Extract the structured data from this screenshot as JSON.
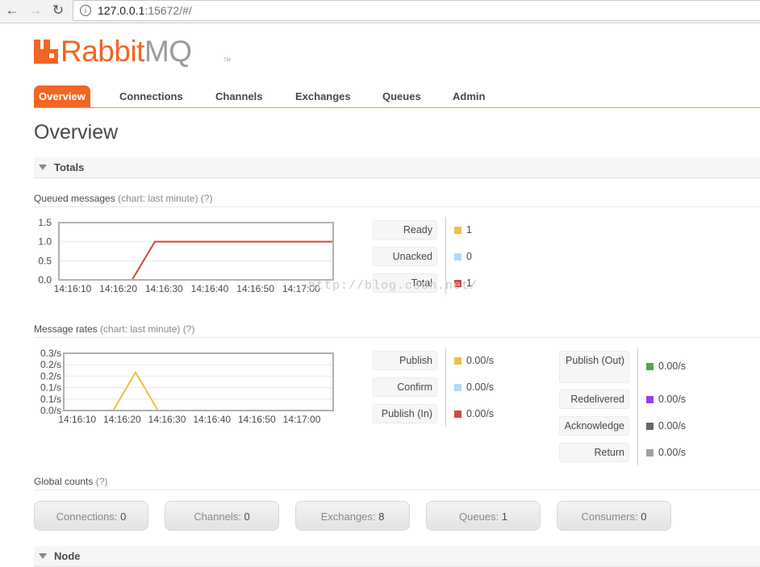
{
  "browser": {
    "url_host": "127.0.0.1",
    "url_rest": ":15672/#/"
  },
  "logo": {
    "brand_primary": "Rabbit",
    "brand_secondary": "MQ",
    "tm": "TM"
  },
  "menu": {
    "items": [
      {
        "label": "Overview",
        "active": true
      },
      {
        "label": "Connections"
      },
      {
        "label": "Channels"
      },
      {
        "label": "Exchanges"
      },
      {
        "label": "Queues"
      },
      {
        "label": "Admin"
      }
    ]
  },
  "page_title": "Overview",
  "totals_header": "Totals",
  "queued": {
    "title": "Queued messages",
    "chart_link": "(chart: last minute)",
    "help": "(?)",
    "legend": [
      {
        "label": "Ready",
        "value": "1",
        "color": "#edc240"
      },
      {
        "label": "Unacked",
        "value": "0",
        "color": "#afd8f8"
      },
      {
        "label": "Total",
        "value": "1",
        "color": "#cb4b4b"
      }
    ]
  },
  "rates": {
    "title": "Message rates",
    "chart_link": "(chart: last minute)",
    "help": "(?)",
    "legend_left": [
      {
        "label": "Publish",
        "value": "0.00/s",
        "color": "#edc240"
      },
      {
        "label": "Confirm",
        "value": "0.00/s",
        "color": "#afd8f8"
      },
      {
        "label": "Publish (In)",
        "value": "0.00/s",
        "color": "#cb4b4b"
      }
    ],
    "legend_right": [
      {
        "label": "Publish (Out)",
        "value": "0.00/s",
        "color": "#4da74d"
      },
      {
        "label": "Redelivered",
        "value": "0.00/s",
        "color": "#9440ed"
      },
      {
        "label": "Acknowledge",
        "value": "0.00/s",
        "color": "#666666"
      },
      {
        "label": "Return",
        "value": "0.00/s",
        "color": "#a0a0a0"
      }
    ]
  },
  "global": {
    "title": "Global counts",
    "help": "(?)",
    "counts": [
      {
        "label": "Connections:",
        "value": "0"
      },
      {
        "label": "Channels:",
        "value": "0"
      },
      {
        "label": "Exchanges:",
        "value": "8"
      },
      {
        "label": "Queues:",
        "value": "1"
      },
      {
        "label": "Consumers:",
        "value": "0"
      }
    ]
  },
  "node_header": "Node",
  "watermark": "http://blog.csdn.net/",
  "chart_data": [
    {
      "type": "line",
      "title": "Queued messages",
      "x": [
        "14:16:10",
        "14:16:20",
        "14:16:30",
        "14:16:40",
        "14:16:50",
        "14:17:00"
      ],
      "ylim": [
        0,
        1.5
      ],
      "yticks": [
        "0.0",
        "0.5",
        "1.0",
        "1.5"
      ],
      "series": [
        {
          "name": "Ready",
          "color": "#edc240",
          "points": [
            [
              "14:16:07",
              0
            ],
            [
              "14:16:23",
              0
            ],
            [
              "14:16:28",
              1
            ],
            [
              "14:17:07",
              1
            ]
          ]
        },
        {
          "name": "Unacked",
          "color": "#afd8f8",
          "points": [
            [
              "14:16:07",
              0
            ],
            [
              "14:17:07",
              0
            ]
          ]
        },
        {
          "name": "Total",
          "color": "#cb4b4b",
          "points": [
            [
              "14:16:07",
              0
            ],
            [
              "14:16:23",
              0
            ],
            [
              "14:16:28",
              1
            ],
            [
              "14:17:07",
              1
            ]
          ]
        }
      ]
    },
    {
      "type": "line",
      "title": "Message rates",
      "x": [
        "14:16:10",
        "14:16:20",
        "14:16:30",
        "14:16:40",
        "14:16:50",
        "14:17:00"
      ],
      "ylim": [
        0,
        0.3
      ],
      "yticks": [
        "0.0/s",
        "0.1/s",
        "0.1/s",
        "0.2/s",
        "0.2/s",
        "0.3/s"
      ],
      "series": [
        {
          "name": "Publish",
          "color": "#edc240",
          "points": [
            [
              "14:16:18",
              0
            ],
            [
              "14:16:23",
              0.2
            ],
            [
              "14:16:28",
              0
            ]
          ]
        }
      ]
    }
  ]
}
